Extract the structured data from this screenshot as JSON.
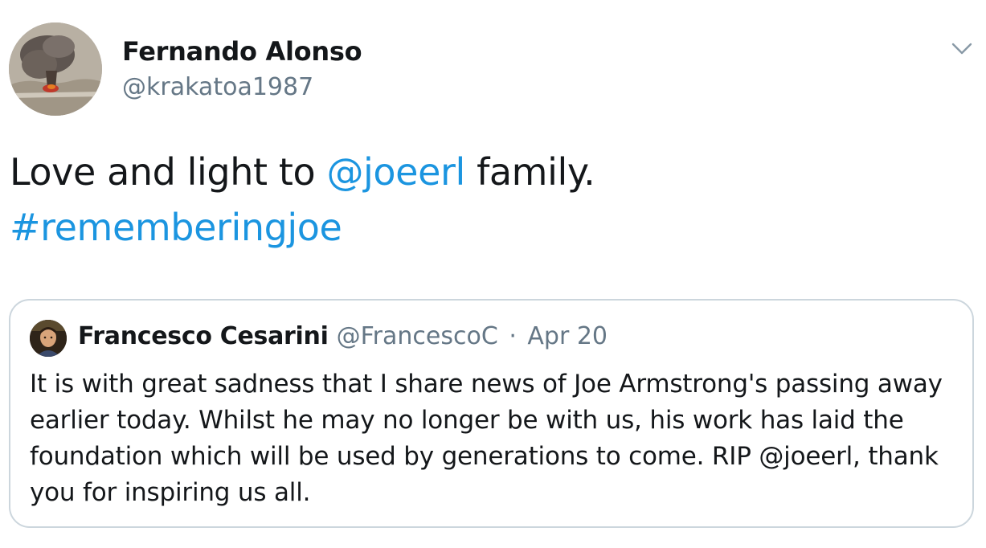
{
  "author": {
    "name": "Fernando Alonso",
    "handle": "@krakatoa1987"
  },
  "tweet": {
    "text_before": "Love and light to ",
    "mention": "@joeerl",
    "text_after": " family.",
    "hashtag": "#rememberingjoe"
  },
  "quoted": {
    "name": "Francesco Cesarini",
    "handle": "@FrancescoC",
    "separator": "·",
    "date": "Apr 20",
    "text": "It is with great sadness that I share news of Joe Armstrong's passing away earlier today. Whilst he may no longer be with us, his work has laid the foundation which will be used by generations to come. RIP @joeerl, thank you for inspiring us all."
  },
  "icons": {
    "menu": "chevron-down-icon"
  },
  "colors": {
    "link": "#1b95e0",
    "secondary_text": "#657786",
    "border": "#ccd6dd",
    "primary_text": "#14171a"
  }
}
